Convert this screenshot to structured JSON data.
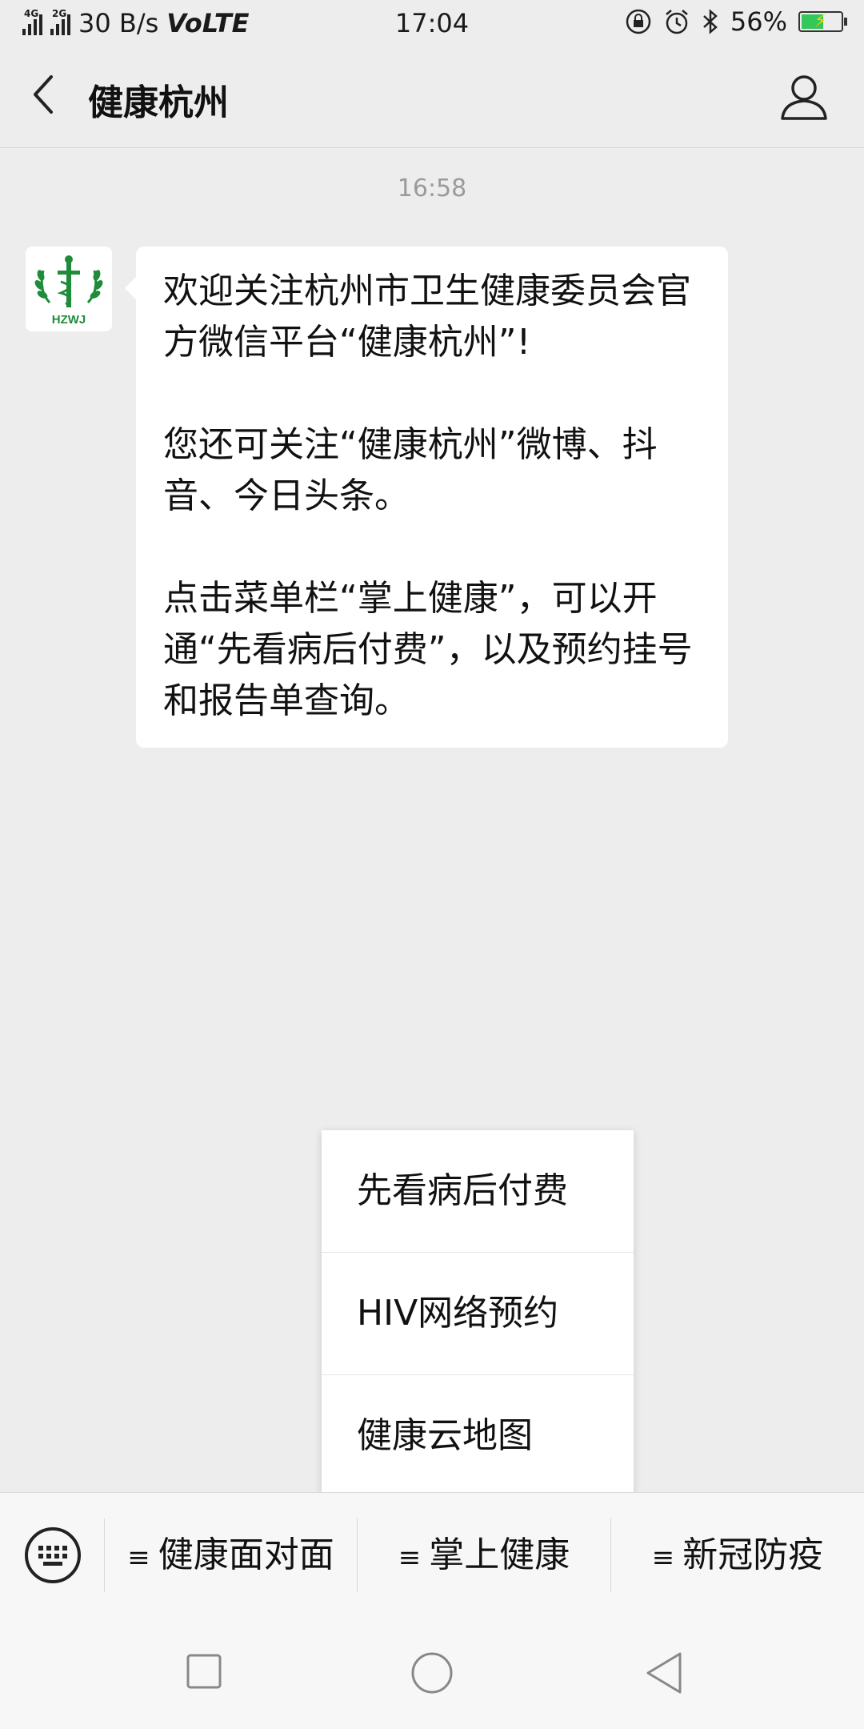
{
  "status_bar": {
    "net_4g": "4G",
    "net_2g": "2G",
    "speed": "30 B/s",
    "volte": "VoLTE",
    "time": "17:04",
    "battery_percent": "56%",
    "battery_level": 0.56
  },
  "header": {
    "title": "健康杭州"
  },
  "chat": {
    "timestamp": "16:58",
    "avatar_text": "HZWJ",
    "message": {
      "p1": "欢迎关注杭州市卫生健康委员会官方微信平台“健康杭州”!",
      "p2": "您还可关注“健康杭州”微博、抖音、今日头条。",
      "p3": "点击菜单栏“掌上健康”，可以开通“先看病后付费”，以及预约挂号和报告单查询。"
    }
  },
  "submenu": {
    "items": [
      "先看病后付费",
      "HIV网络预约",
      "健康云地图"
    ]
  },
  "menu_bar": {
    "items": [
      "健康面对面",
      "掌上健康",
      "新冠防疫"
    ],
    "hamburger": "≡"
  },
  "colors": {
    "background": "#ededed",
    "logo_green": "#1e8c3a",
    "battery_green": "#34c759"
  },
  "icons": [
    "signal-icon",
    "lock-rotation-icon",
    "alarm-icon",
    "bluetooth-icon",
    "battery-icon",
    "back-arrow-icon",
    "profile-icon",
    "keyboard-icon",
    "square-nav-icon",
    "circle-nav-icon",
    "triangle-back-nav-icon"
  ]
}
